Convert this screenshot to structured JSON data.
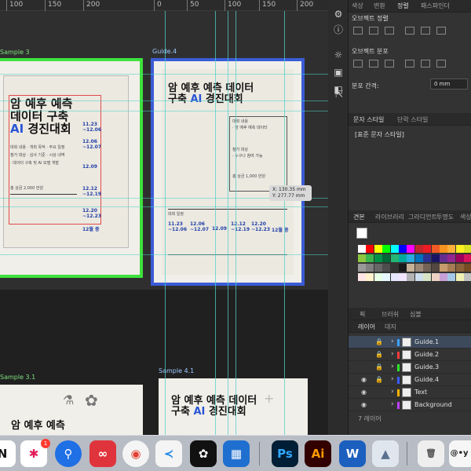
{
  "ruler": {
    "ticks": [
      "100",
      "150",
      "200",
      "0",
      "50",
      "100",
      "150",
      "200"
    ]
  },
  "canvas": {
    "artboards": [
      {
        "label": "Sample 3"
      },
      {
        "label": "Guide.4"
      },
      {
        "label": "Sample 3.1"
      },
      {
        "label": "Sample 4.1"
      }
    ],
    "poster_left": {
      "title_line1": "암 예후 예측",
      "title_line2": "데이터 구축",
      "title_ai": "AI",
      "title_line3": "경진대회",
      "dates": [
        "11.23\n~12.06",
        "12.06\n~12.07",
        "12.09",
        "12.12\n~12.19",
        "12.20\n~12.23",
        "12월 중"
      ]
    },
    "poster_center": {
      "title_line1": "암 예후 예측 데이터",
      "title_line2_a": "구축",
      "title_ai": "AI",
      "title_line2_b": "경진대회",
      "dates": [
        "11.23\n~12.06",
        "12.06\n~12.07",
        "12.09",
        "12.12\n~12.19",
        "12.20\n~12.23",
        "12월 중"
      ]
    },
    "poster_bottom": {
      "title_line1": "암 예후 예측 데이터",
      "title_line2_a": "구축",
      "title_ai": "AI",
      "title_line2_b": "경진대회"
    },
    "poster_bottom_left": {
      "title": "암 예후 예측"
    },
    "tooltip": {
      "x": "X: 130.35 mm",
      "y": "Y: 277.77 mm"
    }
  },
  "panel": {
    "top_tabs": [
      "색상",
      "변환",
      "정렬",
      "패스파인더"
    ],
    "align_section": "오브젝트 정렬",
    "distribute_section": "오브젝트 분포",
    "spacing_label": "분포 간격:",
    "spacing_value": "0 mm",
    "char_styles_tab": "문자 스타일",
    "para_styles_tab": "단락 스타일",
    "default_style": "[표준 문자 스타일]",
    "swatch_tabs": [
      "견본",
      "라이브러리",
      "그라디언트",
      "투명도",
      "색상"
    ],
    "layers_tabs": [
      "획",
      "브러쉬",
      "심볼"
    ],
    "layers_tab2": [
      "레이어",
      "대지"
    ],
    "layers": [
      {
        "name": "Guide.1",
        "color": "#3ea3ff"
      },
      {
        "name": "Guide.2",
        "color": "#ff3c3c"
      },
      {
        "name": "Guide.3",
        "color": "#2ee62e"
      },
      {
        "name": "Guide.4",
        "color": "#3a5cff"
      },
      {
        "name": "Text",
        "color": "#ffb400"
      },
      {
        "name": "Background",
        "color": "#c040ff"
      }
    ],
    "layer_count": "7 레이어"
  },
  "dock": {
    "apps": [
      {
        "name": "notion",
        "glyph": "N",
        "color": "#ffffff"
      },
      {
        "name": "slack",
        "glyph": "✱",
        "color": "#ffffff"
      },
      {
        "name": "maps-pin",
        "glyph": "●",
        "color": "#1f6fe5"
      },
      {
        "name": "creative-cloud",
        "glyph": "∞",
        "color": "#e0343c"
      },
      {
        "name": "chrome",
        "glyph": "◉",
        "color": "#f1c40f"
      },
      {
        "name": "vscode",
        "glyph": "≺",
        "color": "#1e88e5"
      },
      {
        "name": "figma",
        "glyph": "✿",
        "color": "#111111"
      },
      {
        "name": "security",
        "glyph": "▦",
        "color": "#1f6fd0"
      },
      {
        "name": "photoshop",
        "glyph": "Ps",
        "color": "#001e36"
      },
      {
        "name": "illustrator",
        "glyph": "Ai",
        "color": "#330000"
      },
      {
        "name": "word",
        "glyph": "W",
        "color": "#1b5fbf"
      },
      {
        "name": "preview",
        "glyph": "▲",
        "color": "#dfe6ee"
      },
      {
        "name": "trash",
        "glyph": "◯",
        "color": "#eeeeee"
      }
    ],
    "slack_badge": "1",
    "social_text": "@•y f"
  },
  "colors": {
    "guide": "#4fd1c5",
    "green_frame": "#3ee23e",
    "blue_frame": "#3a5cd6",
    "accent_blue": "#2a55d6"
  }
}
